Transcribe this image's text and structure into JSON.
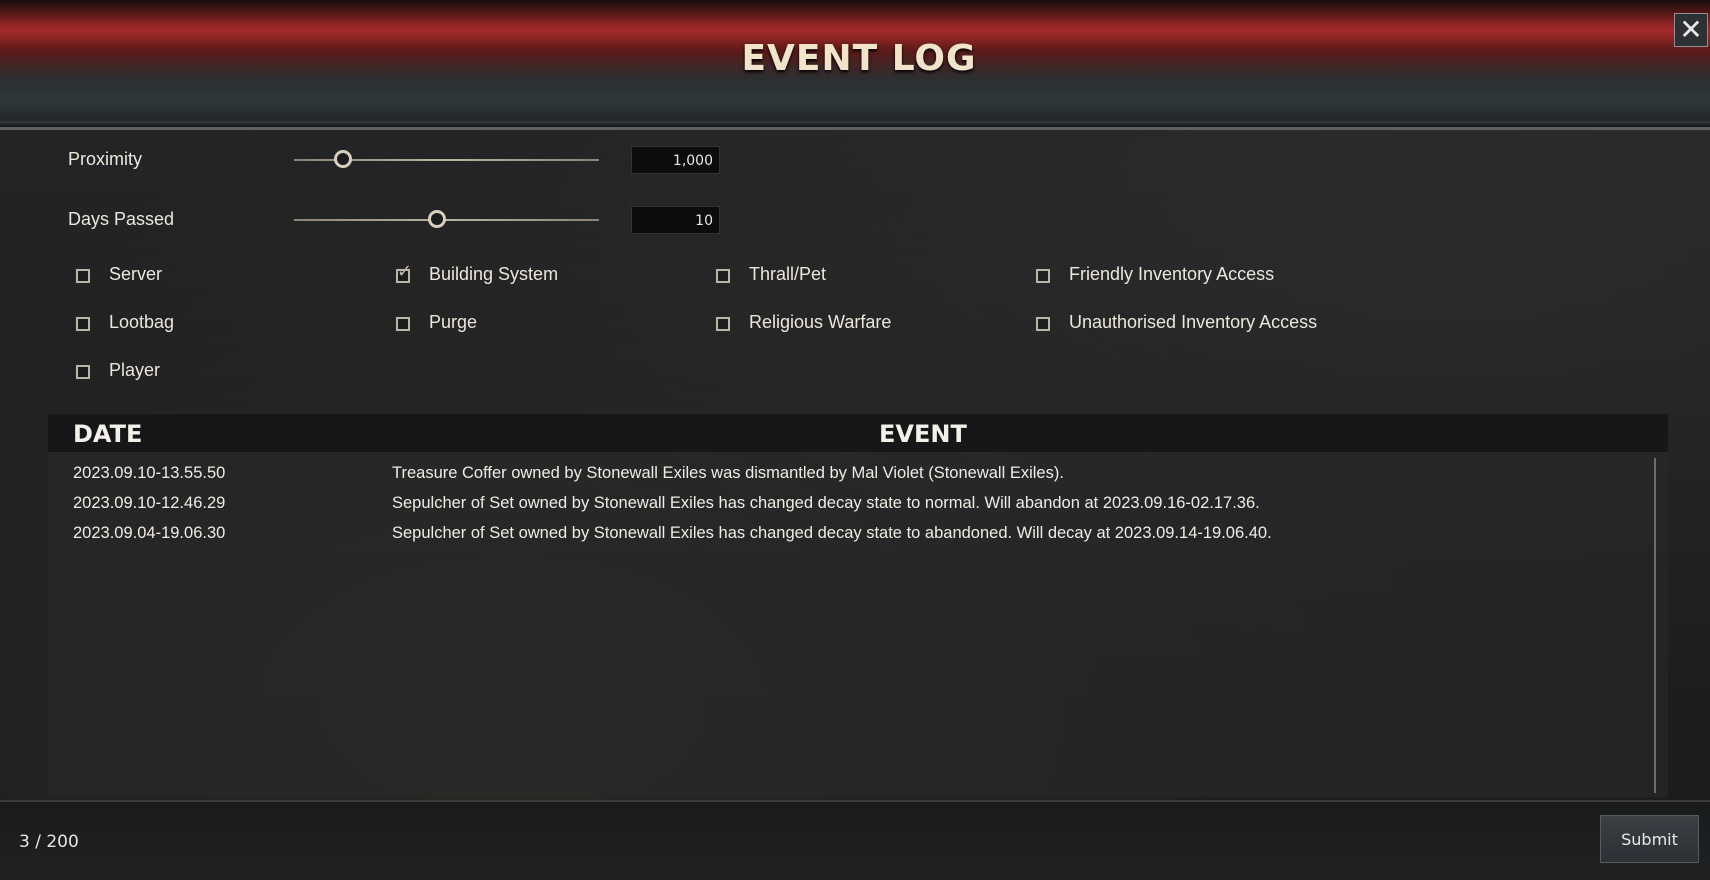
{
  "window": {
    "title": "EVENT LOG",
    "close_icon": "close-icon"
  },
  "filters": {
    "proximity": {
      "label": "Proximity",
      "value": "1,000",
      "slider_fraction": 0.16
    },
    "days_passed": {
      "label": "Days Passed",
      "value": "10",
      "slider_fraction": 0.47
    },
    "categories": [
      {
        "label": "Server",
        "checked": false
      },
      {
        "label": "Building System",
        "checked": true
      },
      {
        "label": "Thrall/Pet",
        "checked": false
      },
      {
        "label": "Friendly Inventory Access",
        "checked": false
      },
      {
        "label": "Lootbag",
        "checked": false
      },
      {
        "label": "Purge",
        "checked": false
      },
      {
        "label": "Religious Warfare",
        "checked": false
      },
      {
        "label": "Unauthorised Inventory Access",
        "checked": false
      },
      {
        "label": "Player",
        "checked": false
      }
    ]
  },
  "table": {
    "columns": [
      "DATE",
      "EVENT"
    ],
    "rows": [
      {
        "date": "2023.09.10-13.55.50",
        "event": "Treasure Coffer owned by Stonewall Exiles was dismantled by Mal Violet (Stonewall Exiles)."
      },
      {
        "date": "2023.09.10-12.46.29",
        "event": "Sepulcher of Set owned by Stonewall Exiles has changed decay state to normal. Will abandon at 2023.09.16-02.17.36."
      },
      {
        "date": "2023.09.04-19.06.30",
        "event": "Sepulcher of Set owned by Stonewall Exiles has changed decay state to abandoned. Will decay at 2023.09.14-19.06.40."
      }
    ]
  },
  "footer": {
    "count": "3 / 200",
    "submit_label": "Submit"
  }
}
